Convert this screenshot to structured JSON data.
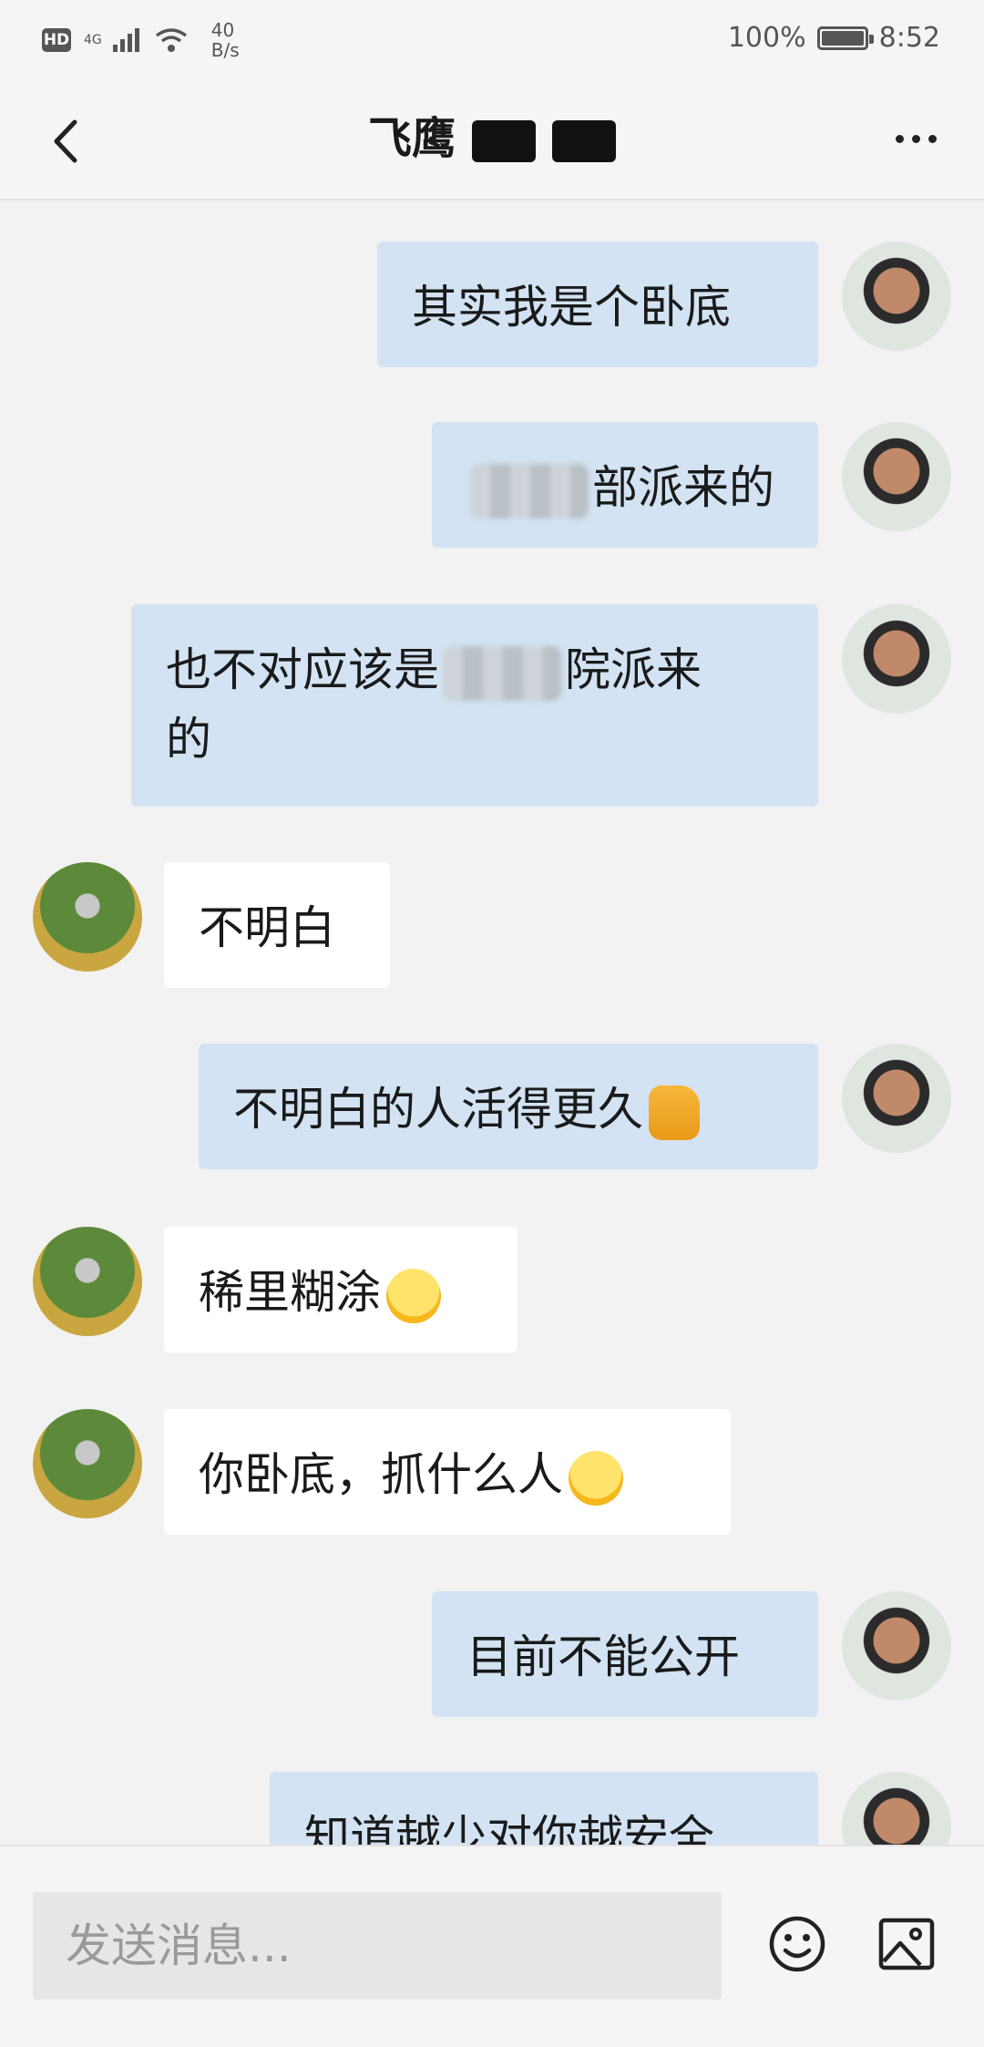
{
  "status_bar": {
    "hd": "HD",
    "network": "4G",
    "speed_value": "40",
    "speed_unit": "B/s",
    "battery": "100%",
    "time": "8:52"
  },
  "header": {
    "title": "飞鹰"
  },
  "messages": [
    {
      "side": "out",
      "text": "其实我是个卧底"
    },
    {
      "side": "out",
      "text_after_redaction": "部派来的"
    },
    {
      "side": "out",
      "text_before_redaction": "也不对应该是",
      "text_after_redaction": "院派来",
      "text_line2": "的"
    },
    {
      "side": "in",
      "text": "不明白"
    },
    {
      "side": "out",
      "text": "不明白的人活得更久",
      "emoji": "thumbs-up"
    },
    {
      "side": "in",
      "text": "稀里糊涂",
      "emoji": "crying-laughing"
    },
    {
      "side": "in",
      "text": "你卧底，抓什么人",
      "emoji": "grinning"
    },
    {
      "side": "out",
      "text": "目前不能公开"
    },
    {
      "side": "out",
      "text": "知道越少对你越安全"
    }
  ],
  "input": {
    "placeholder": "发送消息..."
  },
  "icons": {
    "back": "chevron-left-icon",
    "more": "more-dots-icon",
    "emoji": "emoji-icon",
    "image": "image-icon"
  },
  "colors": {
    "outgoing_bubble": "#d3e3f3",
    "incoming_bubble": "#ffffff",
    "background": "#f2f2f2"
  }
}
